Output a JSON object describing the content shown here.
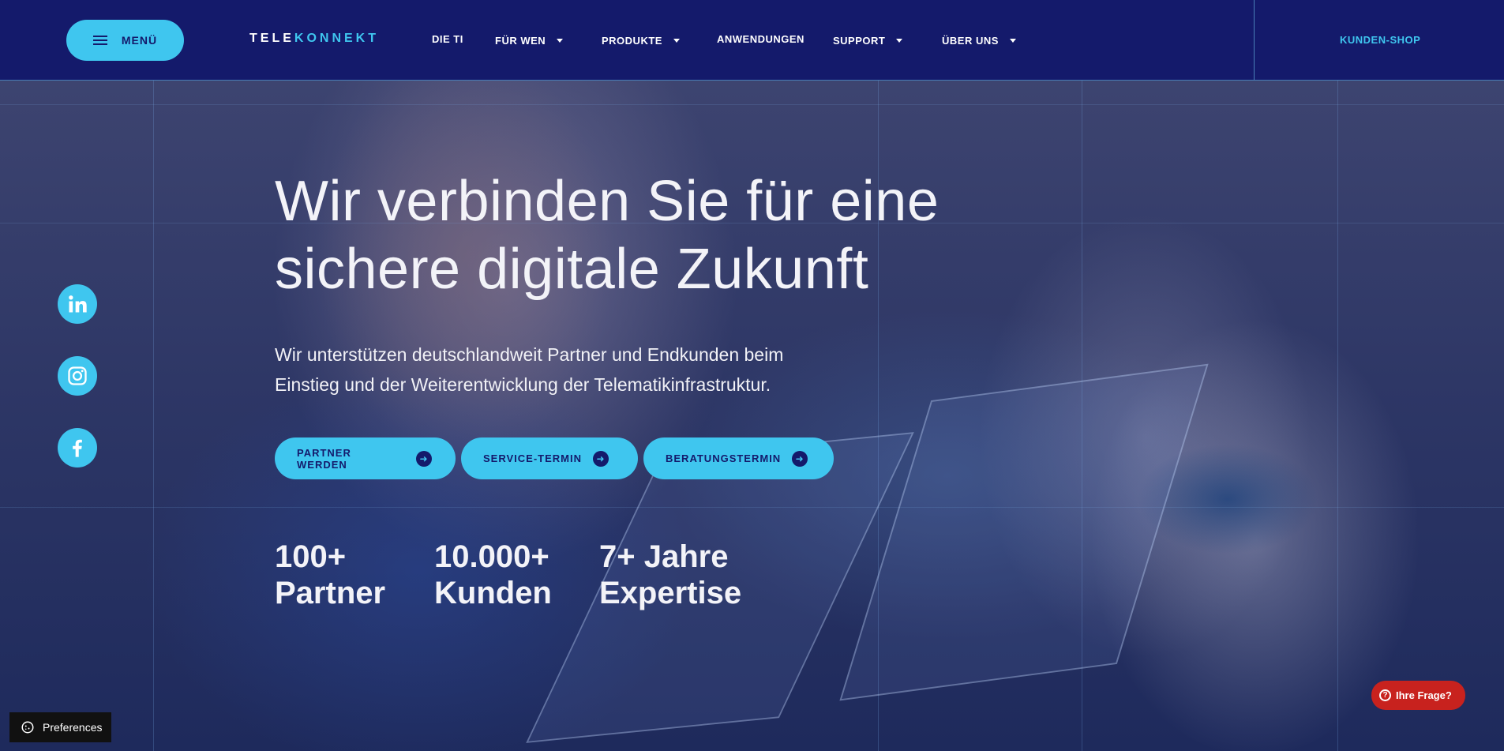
{
  "header": {
    "menu_label": "MENÜ",
    "logo_part1": "TELE",
    "logo_part2": "KONNEKT",
    "nav": [
      {
        "label": "DIE TI",
        "has_dropdown": false
      },
      {
        "label": "FÜR WEN",
        "has_dropdown": true
      },
      {
        "label": "PRODUKTE",
        "has_dropdown": true
      },
      {
        "label": "ANWENDUNGEN",
        "has_dropdown": false
      },
      {
        "label": "SUPPORT",
        "has_dropdown": true
      },
      {
        "label": "ÜBER UNS",
        "has_dropdown": true
      }
    ],
    "shop_label": "KUNDEN-SHOP"
  },
  "hero": {
    "headline_line1": "Wir verbinden Sie für eine",
    "headline_line2": "sichere digitale Zukunft",
    "subtext_line1": "Wir unterstützen deutschlandweit Partner und Endkunden beim",
    "subtext_line2": "Einstieg und der Weiterentwicklung der Telematikinfrastruktur.",
    "ctas": [
      {
        "label": "PARTNER WERDEN"
      },
      {
        "label": "SERVICE-TERMIN"
      },
      {
        "label": "BERATUNGSTERMIN"
      }
    ],
    "stats": [
      {
        "value": "100+",
        "label": "Partner"
      },
      {
        "value": "10.000+",
        "label": "Kunden"
      },
      {
        "value": "7+ Jahre",
        "label": "Expertise"
      }
    ]
  },
  "social": [
    "linkedin-icon",
    "instagram-icon",
    "facebook-icon"
  ],
  "widgets": {
    "preferences_label": "Preferences",
    "faq_label": "Ihre Frage?"
  },
  "colors": {
    "header_bg": "#141a6b",
    "accent": "#3fc6ef",
    "faq_red": "#c8221e"
  }
}
